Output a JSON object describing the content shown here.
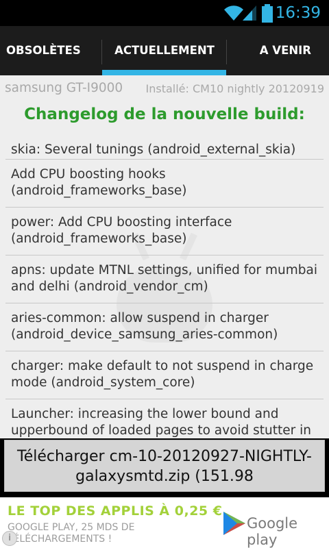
{
  "status_bar": {
    "time": "16:39",
    "icons": [
      "wifi-icon",
      "signal-icon",
      "battery-icon"
    ]
  },
  "tabs": [
    {
      "label": "OBSOLÈTES",
      "active": false
    },
    {
      "label": "ACTUELLEMENT",
      "active": true
    },
    {
      "label": "A VENIR",
      "active": false
    }
  ],
  "device": {
    "name": "samsung GT-I9000",
    "installed": "Installé: CM10 nightly 20120919"
  },
  "changelog": {
    "title": "Changelog de la nouvelle build:",
    "items": [
      "skia: Several tunings (android_external_skia)",
      "Add CPU boosting hooks (android_frameworks_base)",
      "power: Add CPU boosting interface (android_frameworks_base)",
      "apns: update MTNL settings, unified for mumbai and delhi (android_vendor_cm)",
      "aries-common: allow suspend in charger (android_device_samsung_aries-common)",
      "charger: make default to not suspend in charge mode (android_system_core)",
      "Launcher: increasing the lower bound and upperbound of loaded pages to avoid stutter in"
    ]
  },
  "download_button": {
    "label": "Télécharger cm-10-20120927-NIGHTLY-galaxysmtd.zip (151.98"
  },
  "ad": {
    "headline": "LE TOP DES APPLIS À 0,25 €",
    "subtext": "GOOGLE PLAY, 25 MDS DE TÉLÉCHARGEMENTS !",
    "brand": "Google play",
    "colors": {
      "headline": "#a3d13a"
    }
  },
  "colors": {
    "accent": "#33b5e5",
    "title_green": "#2d9b2d"
  }
}
